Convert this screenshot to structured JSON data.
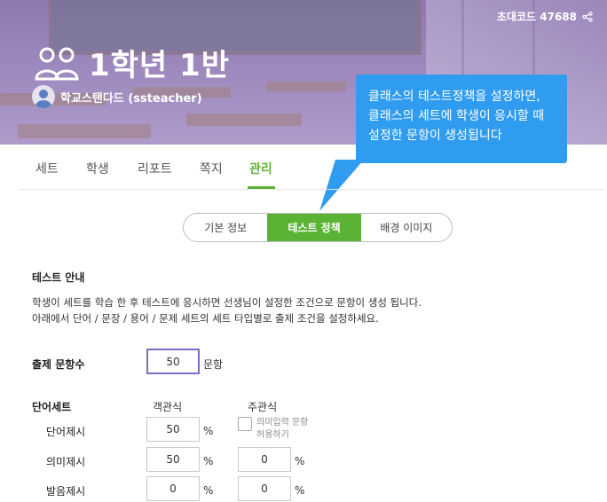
{
  "banner": {
    "class_code": "초대코드 47688",
    "class_name": "1학년 1반",
    "owner": "학교스탠다드  (ssteacher)"
  },
  "callout": {
    "text": "클래스의 테스트정책을 설정하면, 클래스의 세트에 학생이 응시할 때 설정한 문항이 생성됩니다"
  },
  "nav": {
    "items": [
      {
        "label": "세트"
      },
      {
        "label": "학생"
      },
      {
        "label": "리포트"
      },
      {
        "label": "쪽지"
      },
      {
        "label": "관리"
      }
    ],
    "active": "관리"
  },
  "segmented": {
    "options": [
      "기본 정보",
      "테스트 정책",
      "배경 이미지"
    ],
    "selected": "테스트 정책"
  },
  "guide": {
    "title": "테스트 안내",
    "line1": "학생이 세트를 학습 한 후 테스트에 응시하면 선생님이 설정한 조건으로 문항이 생성 됩니다.",
    "line2": "아래에서 단어 / 문장 / 용어 / 문제 세트의 세트 타입별로 출제 조건을 설정하세요."
  },
  "question_count": {
    "label": "출제 문항수",
    "value": "50",
    "unit": "문항"
  },
  "word_set": {
    "label": "단어세트",
    "col_objective": "객관식",
    "col_subjective": "주관식",
    "allow_meaning_input": "의미입력 문항 허용하기",
    "allow_meaning_checked": false,
    "rows": [
      {
        "label": "단어제시",
        "objective": "50",
        "subjective": null
      },
      {
        "label": "의미제시",
        "objective": "50",
        "subjective": "0"
      },
      {
        "label": "발음제시",
        "objective": "0",
        "subjective": "0"
      }
    ],
    "percent": "%"
  },
  "colors": {
    "accent_green": "#5ab334",
    "callout_blue": "#2f9cf0",
    "focus_purple": "#7b6cc4"
  }
}
